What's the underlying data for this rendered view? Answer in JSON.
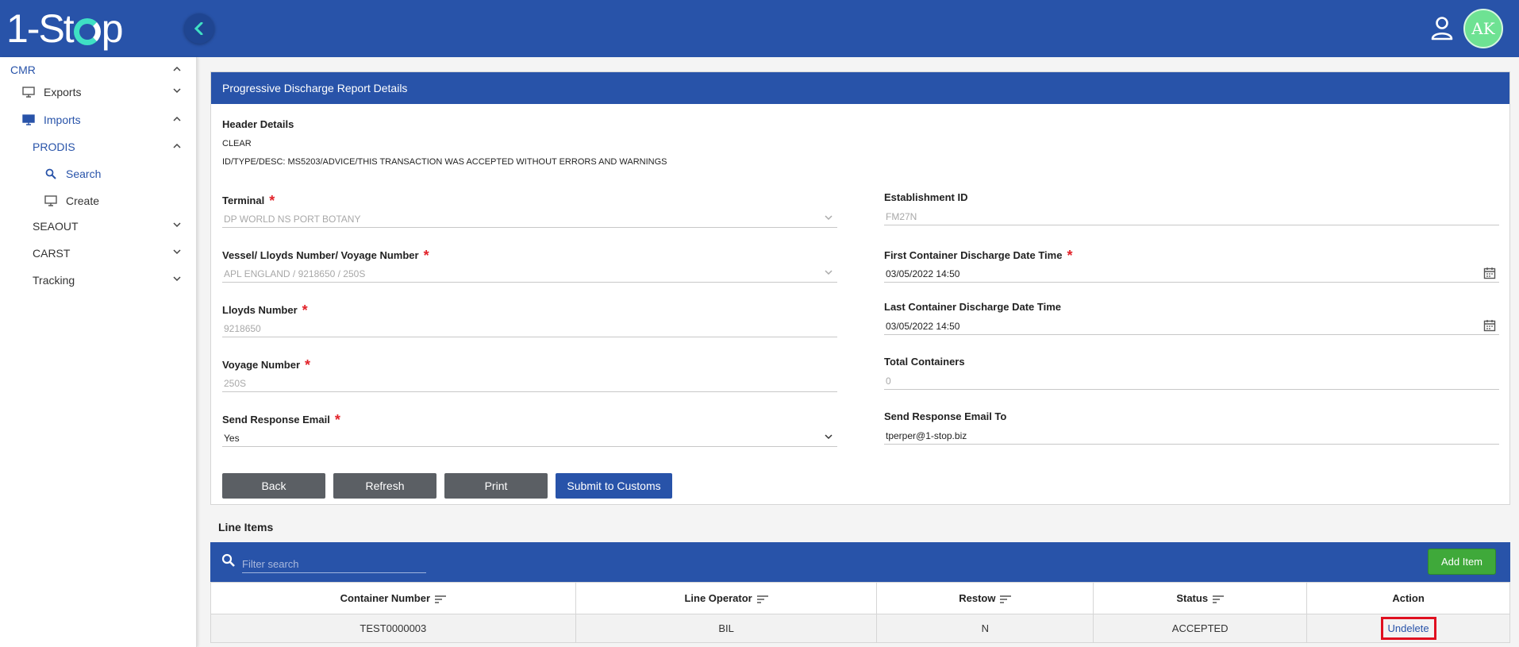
{
  "app": {
    "logo_text_1": "1-St",
    "logo_text_2": "p",
    "avatar_initials": "AK"
  },
  "sidebar": {
    "cmr": "CMR",
    "exports": "Exports",
    "imports": "Imports",
    "prodis": "PRODIS",
    "search": "Search",
    "create": "Create",
    "seaout": "SEAOUT",
    "carst": "CARST",
    "tracking": "Tracking"
  },
  "panel": {
    "title": "Progressive Discharge Report Details",
    "header_details_title": "Header Details",
    "header_status": "CLEAR",
    "header_desc": "ID/TYPE/DESC: MS5203/ADVICE/THIS TRANSACTION WAS ACCEPTED WITHOUT ERRORS AND WARNINGS"
  },
  "form": {
    "terminal": {
      "label": "Terminal",
      "value": "DP WORLD NS PORT BOTANY"
    },
    "vessel": {
      "label": "Vessel/ Lloyds Number/ Voyage Number",
      "value": "APL ENGLAND / 9218650 / 250S"
    },
    "lloyds": {
      "label": "Lloyds Number",
      "value": "9218650"
    },
    "voyage": {
      "label": "Voyage Number",
      "value": "250S"
    },
    "send_email": {
      "label": "Send Response Email",
      "value": "Yes"
    },
    "establishment": {
      "label": "Establishment ID",
      "value": "FM27N"
    },
    "first_discharge": {
      "label": "First Container Discharge Date Time",
      "value": "03/05/2022 14:50"
    },
    "last_discharge": {
      "label": "Last Container Discharge Date Time",
      "value": "03/05/2022 14:50"
    },
    "total_containers": {
      "label": "Total Containers",
      "value": "0"
    },
    "email_to": {
      "label": "Send Response Email To",
      "value": "tperper@1-stop.biz"
    },
    "required_mark": "*"
  },
  "buttons": {
    "back": "Back",
    "refresh": "Refresh",
    "print": "Print",
    "submit": "Submit to Customs"
  },
  "line_items": {
    "title": "Line Items",
    "filter_placeholder": "Filter search",
    "add_item": "Add Item",
    "columns": [
      "Container Number",
      "Line Operator",
      "Restow",
      "Status",
      "Action"
    ],
    "rows": [
      {
        "container": "TEST0000003",
        "operator": "BIL",
        "restow": "N",
        "status": "ACCEPTED",
        "action": "Undelete"
      }
    ]
  }
}
